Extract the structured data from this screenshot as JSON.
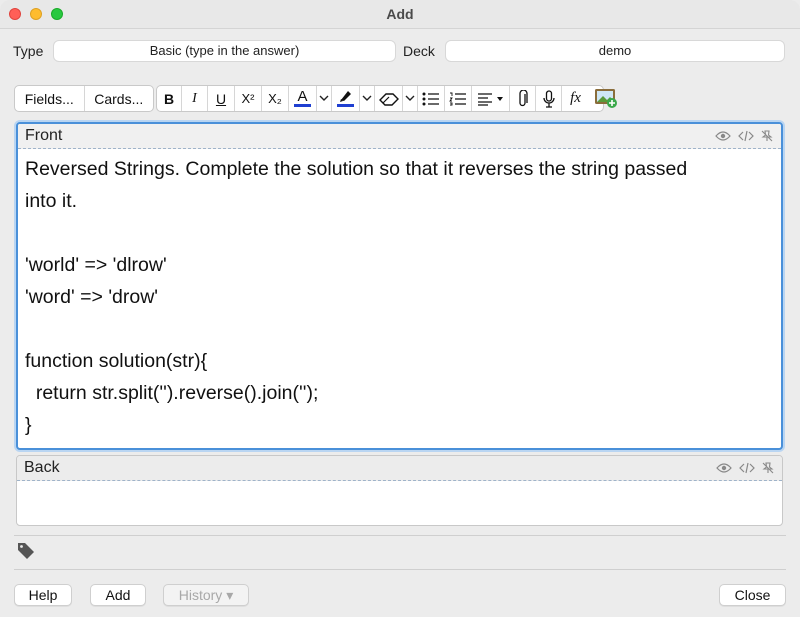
{
  "window": {
    "title": "Add"
  },
  "note": {
    "type_label": "Type",
    "type_value": "Basic (type in the answer)",
    "deck_label": "Deck",
    "deck_value": "demo"
  },
  "toolbar": {
    "fields_label": "Fields...",
    "cards_label": "Cards...",
    "bold_label": "B",
    "italic_label": "I",
    "underline_label": "U",
    "superscript_label": "X²",
    "subscript_label": "X₂",
    "text_color_label": "A",
    "text_color": "#1f3fd1",
    "highlight_color": "#1f3fd1",
    "math_label": "fx"
  },
  "fields": {
    "front": {
      "name": "Front",
      "lines": [
        "Reversed Strings. Complete the solution so that it reverses the string passed",
        "into it.",
        "",
        "'world' => 'dlrow'",
        "'word' => 'drow'",
        "",
        "function solution(str){",
        "  return str.split('').reverse().join('');",
        "}"
      ]
    },
    "back": {
      "name": "Back",
      "lines": []
    }
  },
  "buttons": {
    "help": "Help",
    "add": "Add",
    "history": "History ▾",
    "close": "Close"
  }
}
